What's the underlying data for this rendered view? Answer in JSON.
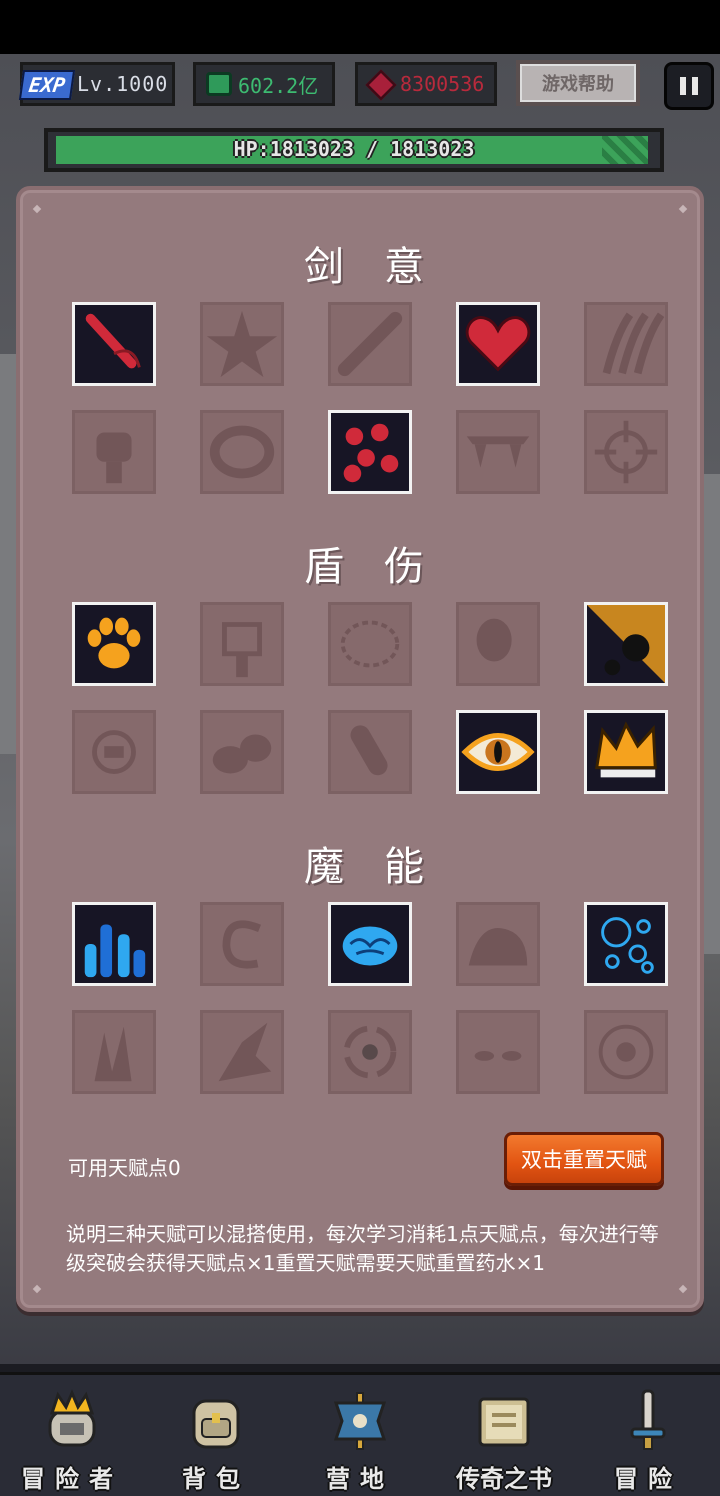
{
  "hud": {
    "exp_badge": "EXP",
    "level": "Lv.1000",
    "gems": "602.2亿",
    "rubies": "8300536",
    "help_label": "游戏帮助",
    "hp_text": "HP:1813023 / 1813023"
  },
  "talents": {
    "sections": [
      {
        "title": "剑意",
        "color": "red",
        "cells": [
          {
            "icon": "blood-sword-icon",
            "unlocked": true
          },
          {
            "icon": "starfish-icon",
            "unlocked": false
          },
          {
            "icon": "bandaged-blade-icon",
            "unlocked": false
          },
          {
            "icon": "heart-icon",
            "unlocked": true
          },
          {
            "icon": "claw-slash-icon",
            "unlocked": false
          },
          {
            "icon": "fist-icon",
            "unlocked": false
          },
          {
            "icon": "ring-icon",
            "unlocked": false
          },
          {
            "icon": "blood-drops-icon",
            "unlocked": true
          },
          {
            "icon": "fangs-icon",
            "unlocked": false
          },
          {
            "icon": "crosshair-icon",
            "unlocked": false
          }
        ]
      },
      {
        "title": "盾伤",
        "color": "orange",
        "cells": [
          {
            "icon": "paw-icon",
            "unlocked": true
          },
          {
            "icon": "totem-icon",
            "unlocked": false
          },
          {
            "icon": "star-frame-icon",
            "unlocked": false
          },
          {
            "icon": "egg-icon",
            "unlocked": false
          },
          {
            "icon": "meteor-icon",
            "unlocked": true
          },
          {
            "icon": "rune-icon",
            "unlocked": false
          },
          {
            "icon": "rocks-icon",
            "unlocked": false
          },
          {
            "icon": "shell-icon",
            "unlocked": false
          },
          {
            "icon": "eye-icon",
            "unlocked": true
          },
          {
            "icon": "crown-flame-icon",
            "unlocked": true
          }
        ]
      },
      {
        "title": "魔能",
        "color": "blue",
        "cells": [
          {
            "icon": "crystal-icon",
            "unlocked": true
          },
          {
            "icon": "swirl-icon",
            "unlocked": false
          },
          {
            "icon": "brain-icon",
            "unlocked": true
          },
          {
            "icon": "wave-icon",
            "unlocked": false
          },
          {
            "icon": "bubbles-icon",
            "unlocked": true
          },
          {
            "icon": "ice-shards-icon",
            "unlocked": false
          },
          {
            "icon": "ice-claw-icon",
            "unlocked": false
          },
          {
            "icon": "vortex-icon",
            "unlocked": false
          },
          {
            "icon": "eyes-icon",
            "unlocked": false
          },
          {
            "icon": "orb-icon",
            "unlocked": false
          }
        ]
      }
    ],
    "points_label": "可用天赋点0",
    "reset_label": "双击重置天赋",
    "description": "说明三种天赋可以混搭使用，每次学习消耗1点天赋点，每次进行等级突破会获得天赋点×1重置天赋需要天赋重置药水×1"
  },
  "nav": {
    "items": [
      {
        "label": "冒险者",
        "icon": "crown-helmet-icon"
      },
      {
        "label": "背包",
        "icon": "backpack-icon"
      },
      {
        "label": "营地",
        "icon": "banner-icon"
      },
      {
        "label": "传奇之书",
        "icon": "book-icon"
      },
      {
        "label": "冒险",
        "icon": "sword-icon"
      }
    ]
  },
  "colors": {
    "panel": "#947a7d",
    "reset_button": "#e25412",
    "hp_fill": "#3ca35a",
    "red": "#d02a3a",
    "orange": "#f5a21e",
    "blue": "#2fa8f0"
  }
}
